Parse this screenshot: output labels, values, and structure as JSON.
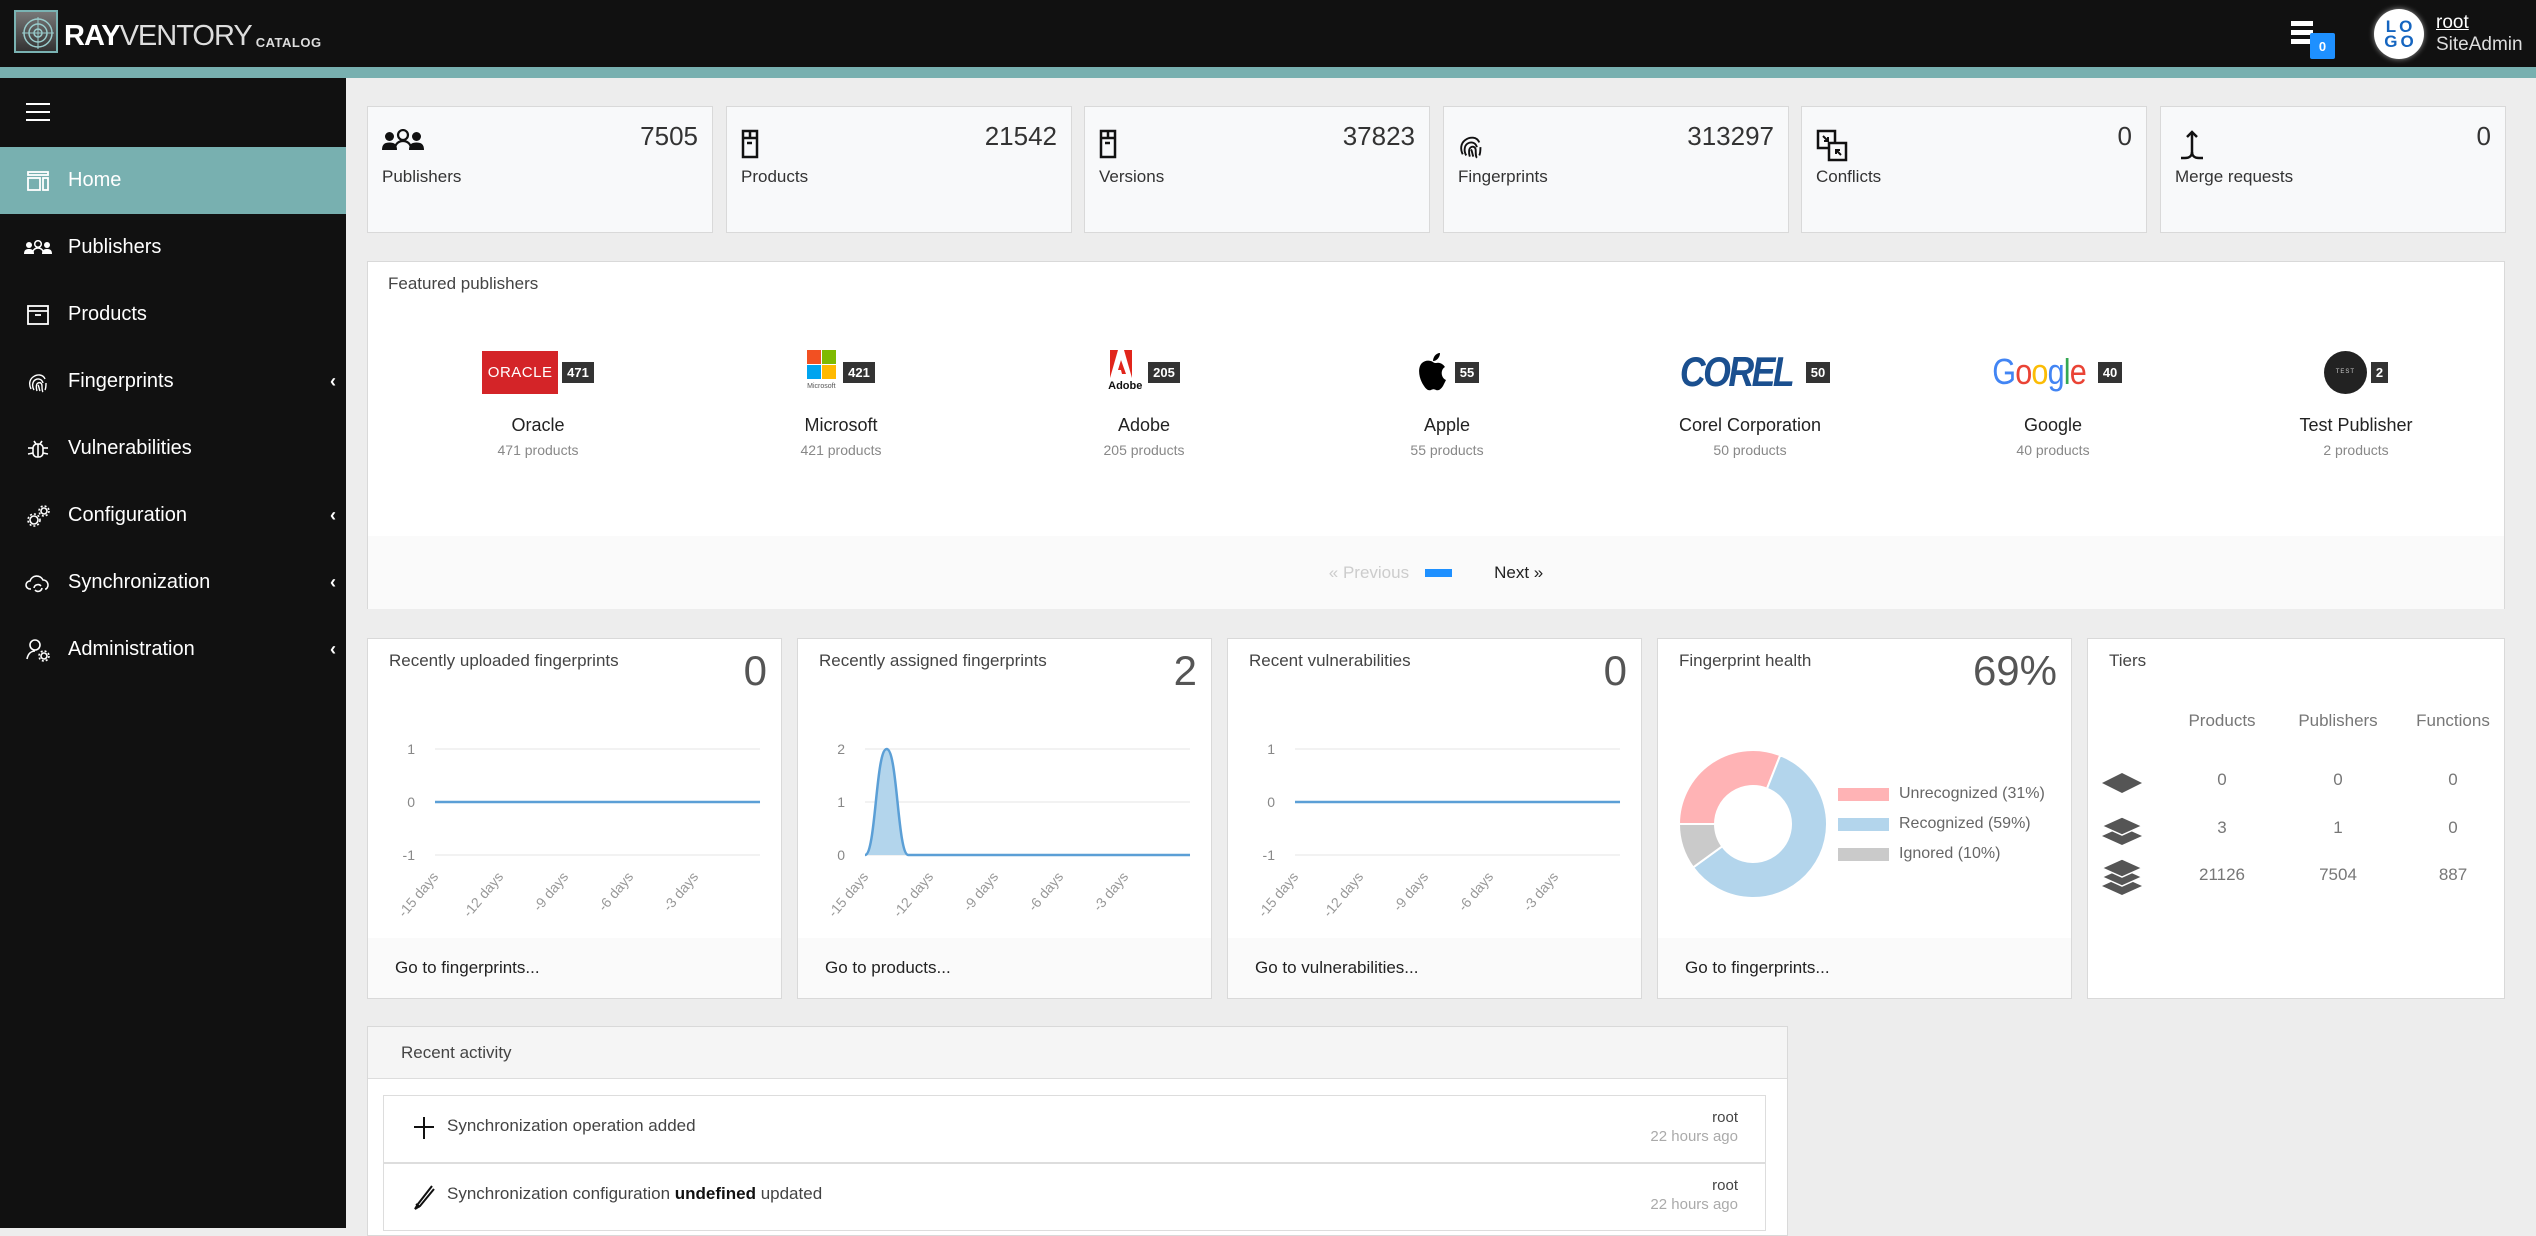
{
  "app": {
    "brand_bold": "RAY",
    "brand_thin": "VENTORY",
    "brand_sub": "CATALOG",
    "notifications_count": "0",
    "avatar_text_top": "LO",
    "avatar_text_bottom": "GO",
    "user_name": "root",
    "user_role": "SiteAdmin",
    "accent_color": "#78b0b0"
  },
  "sidebar": {
    "items": [
      {
        "label": "Home",
        "icon": "home-icon",
        "active": true,
        "expandable": false
      },
      {
        "label": "Publishers",
        "icon": "users-icon",
        "active": false,
        "expandable": false
      },
      {
        "label": "Products",
        "icon": "box-icon",
        "active": false,
        "expandable": false
      },
      {
        "label": "Fingerprints",
        "icon": "fingerprint-icon",
        "active": false,
        "expandable": true
      },
      {
        "label": "Vulnerabilities",
        "icon": "bug-icon",
        "active": false,
        "expandable": false
      },
      {
        "label": "Configuration",
        "icon": "gears-icon",
        "active": false,
        "expandable": true
      },
      {
        "label": "Synchronization",
        "icon": "cloud-sync-icon",
        "active": false,
        "expandable": true
      },
      {
        "label": "Administration",
        "icon": "user-gear-icon",
        "active": false,
        "expandable": true
      }
    ]
  },
  "stats": [
    {
      "label": "Publishers",
      "value": "7505",
      "icon": "users-icon"
    },
    {
      "label": "Products",
      "value": "21542",
      "icon": "box-icon"
    },
    {
      "label": "Versions",
      "value": "37823",
      "icon": "box-icon"
    },
    {
      "label": "Fingerprints",
      "value": "313297",
      "icon": "fingerprint-icon"
    },
    {
      "label": "Conflicts",
      "value": "0",
      "icon": "conflict-icon"
    },
    {
      "label": "Merge requests",
      "value": "0",
      "icon": "merge-icon"
    }
  ],
  "featured": {
    "title": "Featured publishers",
    "publishers": [
      {
        "name": "Oracle",
        "count": "471",
        "products": "471 products"
      },
      {
        "name": "Microsoft",
        "count": "421",
        "products": "421 products"
      },
      {
        "name": "Adobe",
        "count": "205",
        "products": "205 products"
      },
      {
        "name": "Apple",
        "count": "55",
        "products": "55 products"
      },
      {
        "name": "Corel Corporation",
        "count": "50",
        "products": "50 products"
      },
      {
        "name": "Google",
        "count": "40",
        "products": "40 products"
      },
      {
        "name": "Test Publisher",
        "count": "2",
        "products": "2 products"
      }
    ],
    "pager": {
      "prev": "«   Previous",
      "next": "Next   »",
      "current_page": 1
    }
  },
  "widgets": {
    "uploaded": {
      "title": "Recently uploaded fingerprints",
      "value": "0",
      "link": "Go to fingerprints..."
    },
    "assigned": {
      "title": "Recently assigned fingerprints",
      "value": "2",
      "link": "Go to products..."
    },
    "vulns": {
      "title": "Recent vulnerabilities",
      "value": "0",
      "link": "Go to vulnerabilities..."
    },
    "health": {
      "title": "Fingerprint health",
      "value": "69%",
      "link": "Go to fingerprints..."
    },
    "tiers": {
      "title": "Tiers",
      "columns": [
        "Products",
        "Publishers",
        "Functions"
      ],
      "rows": [
        {
          "tier": "tier-1-icon",
          "values": [
            "0",
            "0",
            "0"
          ]
        },
        {
          "tier": "tier-2-icon",
          "values": [
            "3",
            "1",
            "0"
          ]
        },
        {
          "tier": "tier-3-icon",
          "values": [
            "21126",
            "7504",
            "887"
          ]
        }
      ]
    }
  },
  "chart_data": [
    {
      "type": "line",
      "title": "Recently uploaded fingerprints",
      "x_ticks": [
        "-15 days",
        "-12 days",
        "-9 days",
        "-6 days",
        "-3 days"
      ],
      "x": [
        -15,
        -14,
        -13,
        -12,
        -11,
        -10,
        -9,
        -8,
        -7,
        -6,
        -5,
        -4,
        -3,
        -2,
        -1,
        0
      ],
      "values": [
        0,
        0,
        0,
        0,
        0,
        0,
        0,
        0,
        0,
        0,
        0,
        0,
        0,
        0,
        0,
        0
      ],
      "y_ticks": [
        "1",
        "0",
        "-1"
      ],
      "ylim": [
        -1,
        1
      ],
      "color": "#5b9fd6"
    },
    {
      "type": "area",
      "title": "Recently assigned fingerprints",
      "x_ticks": [
        "-15 days",
        "-12 days",
        "-9 days",
        "-6 days",
        "-3 days"
      ],
      "x": [
        -15,
        -14,
        -13,
        -12,
        -11,
        -10,
        -9,
        -8,
        -7,
        -6,
        -5,
        -4,
        -3,
        -2,
        -1,
        0
      ],
      "values": [
        0,
        2,
        0,
        0,
        0,
        0,
        0,
        0,
        0,
        0,
        0,
        0,
        0,
        0,
        0,
        0
      ],
      "y_ticks": [
        "2",
        "1",
        "0"
      ],
      "ylim": [
        0,
        2
      ],
      "color": "#5b9fd6"
    },
    {
      "type": "line",
      "title": "Recent vulnerabilities",
      "x_ticks": [
        "-15 days",
        "-12 days",
        "-9 days",
        "-6 days",
        "-3 days"
      ],
      "x": [
        -15,
        -14,
        -13,
        -12,
        -11,
        -10,
        -9,
        -8,
        -7,
        -6,
        -5,
        -4,
        -3,
        -2,
        -1,
        0
      ],
      "values": [
        0,
        0,
        0,
        0,
        0,
        0,
        0,
        0,
        0,
        0,
        0,
        0,
        0,
        0,
        0,
        0
      ],
      "y_ticks": [
        "1",
        "0",
        "-1"
      ],
      "ylim": [
        -1,
        1
      ],
      "color": "#5b9fd6"
    },
    {
      "type": "pie",
      "title": "Fingerprint health",
      "donut": true,
      "slices": [
        {
          "label": "Unrecognized (31%)",
          "value": 31,
          "color": "#ffb3b5"
        },
        {
          "label": "Recognized (59%)",
          "value": 59,
          "color": "#b3d5ec"
        },
        {
          "label": "Ignored (10%)",
          "value": 10,
          "color": "#cacaca"
        }
      ],
      "legend": "right"
    }
  ],
  "activity": {
    "title": "Recent activity",
    "items": [
      {
        "icon": "plus-icon",
        "text_before": "Synchronization operation added",
        "text_bold": "",
        "text_after": "",
        "user": "root",
        "time": "22 hours ago"
      },
      {
        "icon": "pencil-icon",
        "text_before": "Synchronization configuration ",
        "text_bold": "undefined",
        "text_after": " updated",
        "user": "root",
        "time": "22 hours ago"
      }
    ]
  }
}
